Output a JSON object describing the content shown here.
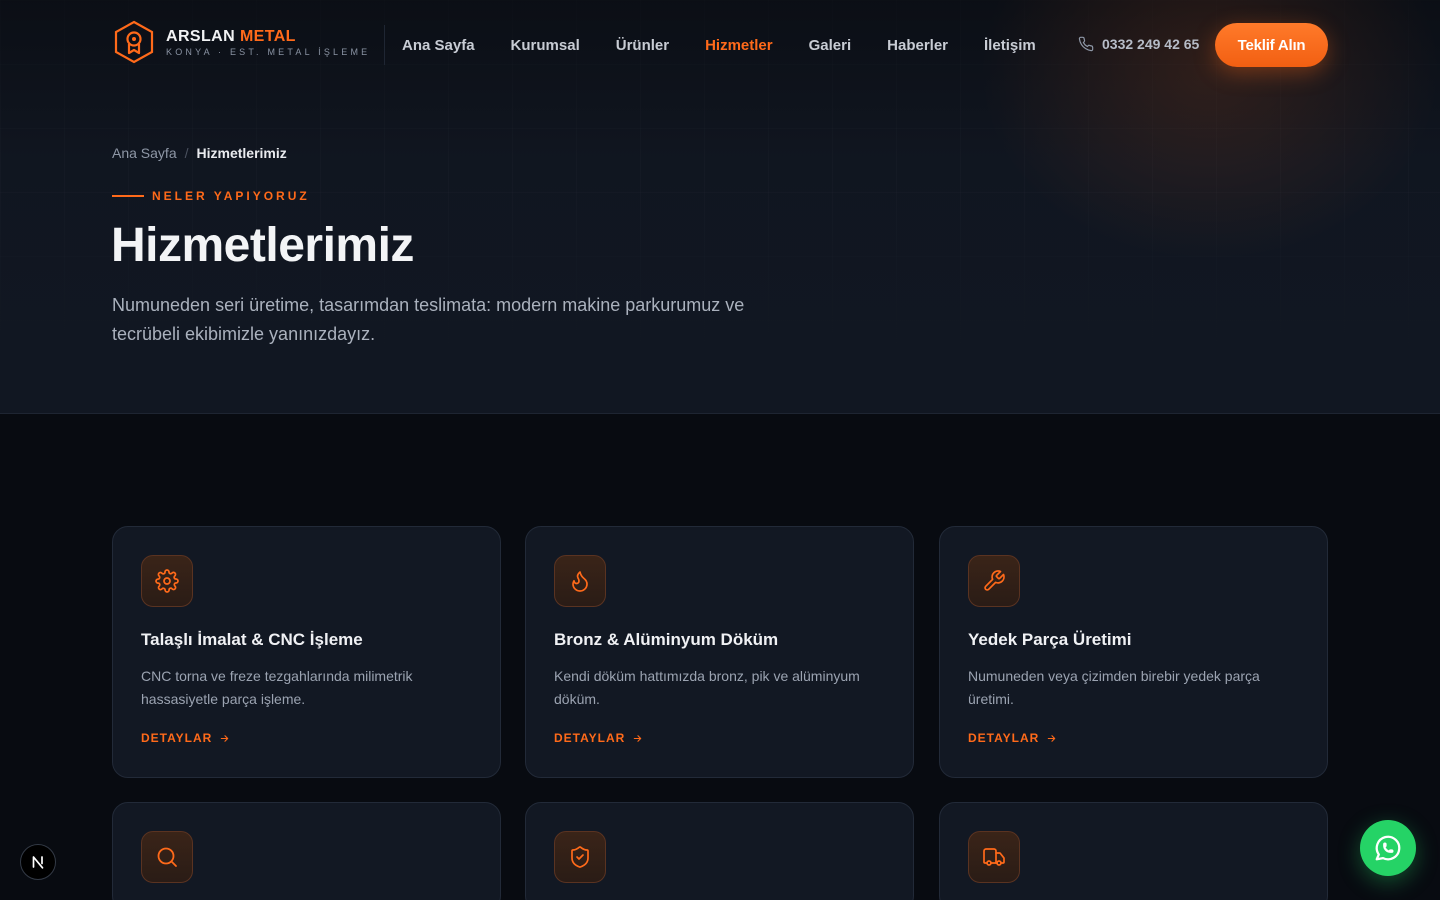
{
  "header": {
    "brand_part1": "ARSLAN",
    "brand_part2": "METAL",
    "tagline": "KONYA · EST. METAL İŞLEME",
    "nav": [
      {
        "label": "Ana Sayfa"
      },
      {
        "label": "Kurumsal"
      },
      {
        "label": "Ürünler"
      },
      {
        "label": "Hizmetler",
        "active": true
      },
      {
        "label": "Galeri"
      },
      {
        "label": "Haberler"
      },
      {
        "label": "İletişim"
      }
    ],
    "phone": "0332 249 42 65",
    "cta_label": "Teklif Alın"
  },
  "hero": {
    "breadcrumb": {
      "home": "Ana Sayfa",
      "separator": "/",
      "current": "Hizmetlerimiz"
    },
    "eyebrow": "NELER YAPIYORUZ",
    "title": "Hizmetlerimiz",
    "lead": "Numuneden seri üretime, tasarımdan teslimata: modern makine parkurumuz ve tecrübeli ekibimizle yanınızdayız."
  },
  "services": [
    {
      "icon": "gear-icon",
      "title": "Talaşlı İmalat & CNC İşleme",
      "desc": "CNC torna ve freze tezgahlarında milimetrik hassasiyetle parça işleme.",
      "link": "DETAYLAR"
    },
    {
      "icon": "flame-icon",
      "title": "Bronz & Alüminyum Döküm",
      "desc": "Kendi döküm hattımızda bronz, pik ve alüminyum döküm.",
      "link": "DETAYLAR"
    },
    {
      "icon": "wrench-icon",
      "title": "Yedek Parça Üretimi",
      "desc": "Numuneden veya çizimden birebir yedek parça üretimi.",
      "link": "DETAYLAR"
    },
    {
      "icon": "search-icon"
    },
    {
      "icon": "shield-check-icon"
    },
    {
      "icon": "truck-icon"
    }
  ],
  "colors": {
    "accent": "#ff6a1a",
    "background": "#080b11",
    "hero_bg": "#111722",
    "card_bg": "#121823",
    "whatsapp": "#25d366"
  },
  "floating": {
    "nextjs_badge": "N",
    "whatsapp_icon": "whatsapp-icon"
  }
}
